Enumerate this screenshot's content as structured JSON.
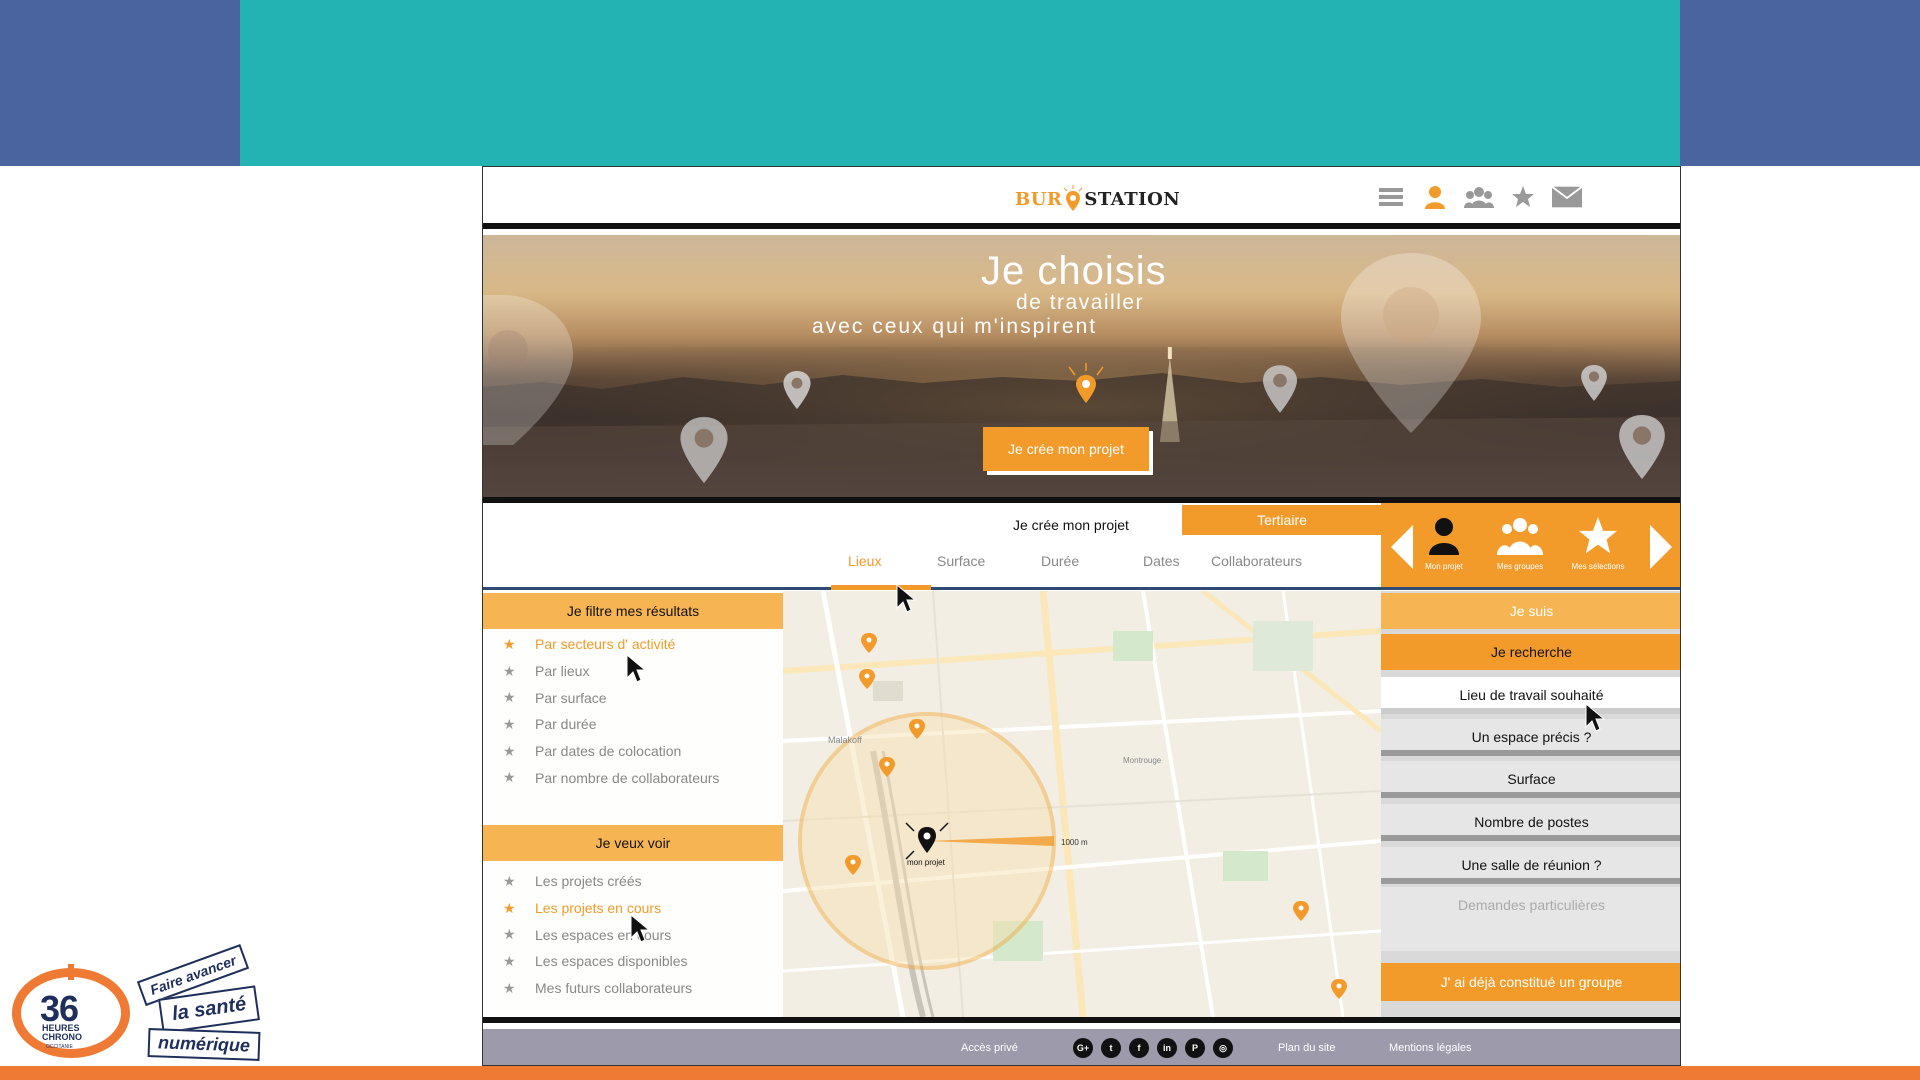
{
  "colors": {
    "teal_band": "#23b3b3",
    "blue_band": "#4a64a0",
    "orange_accent": "#f29b2a",
    "orange_bottom_band": "#ef7a34",
    "footer_gray": "#9c9aab"
  },
  "header": {
    "logo_part1": "BUR",
    "logo_part2": "STATION",
    "icons": [
      "menu-icon",
      "user-icon",
      "group-icon",
      "star-icon",
      "mail-icon"
    ]
  },
  "hero": {
    "title": "Je choisis",
    "subtitle": "de travailler",
    "tagline": "avec ceux qui m'inspirent",
    "cta": "Je crée mon projet"
  },
  "project_bar": {
    "label": "Je crée mon projet",
    "category": "Tertiaire",
    "tabs": [
      "Lieux",
      "Surface",
      "Durée",
      "Dates",
      "Collaborateurs"
    ],
    "active_tab": "Lieux"
  },
  "nav_panel": {
    "items": [
      {
        "label": "Mon projet",
        "icon": "person-icon"
      },
      {
        "label": "Mes groupes",
        "icon": "group-icon"
      },
      {
        "label": "Mes sélections",
        "icon": "star-icon"
      }
    ]
  },
  "left_panel": {
    "filter_heading": "Je filtre mes résultats",
    "filters": [
      "Par secteurs d' activité",
      "Par lieux",
      "Par surface",
      "Par durée",
      "Par dates de colocation",
      "Par nombre de collaborateurs"
    ],
    "active_filter": "Par secteurs d' activité",
    "view_heading": "Je veux voir",
    "views": [
      "Les projets créés",
      "Les projets en cours",
      "Les espaces en cours",
      "Les espaces disponibles",
      "Mes futurs collaborateurs"
    ],
    "active_view": "Les projets en cours"
  },
  "map": {
    "radius_label": "1000 m",
    "center_label": "mon projet",
    "area_labels": [
      "Malakoff",
      "Montrouge"
    ]
  },
  "right_panel": {
    "heading_1": "Je suis",
    "heading_2": "Je recherche",
    "items": [
      "Lieu de travail souhaité",
      "Un espace précis ?",
      "Surface",
      "Nombre de postes",
      "Une salle de réunion ?"
    ],
    "selected_item": "Lieu de travail souhaité",
    "demandes": "Demandes particulières",
    "group_button": "J' ai déjà constitué un groupe"
  },
  "footer": {
    "private_access": "Accès privé",
    "social": [
      "G+",
      "t",
      "f",
      "in",
      "P",
      "◎"
    ],
    "sitemap": "Plan du site",
    "legal": "Mentions légales"
  },
  "badge": {
    "number": "36",
    "line1": "HEURES",
    "line2": "CHRONO",
    "region": "OCCITANIE",
    "card1": "Faire avancer",
    "card2": "la santé",
    "card3": "numérique"
  }
}
